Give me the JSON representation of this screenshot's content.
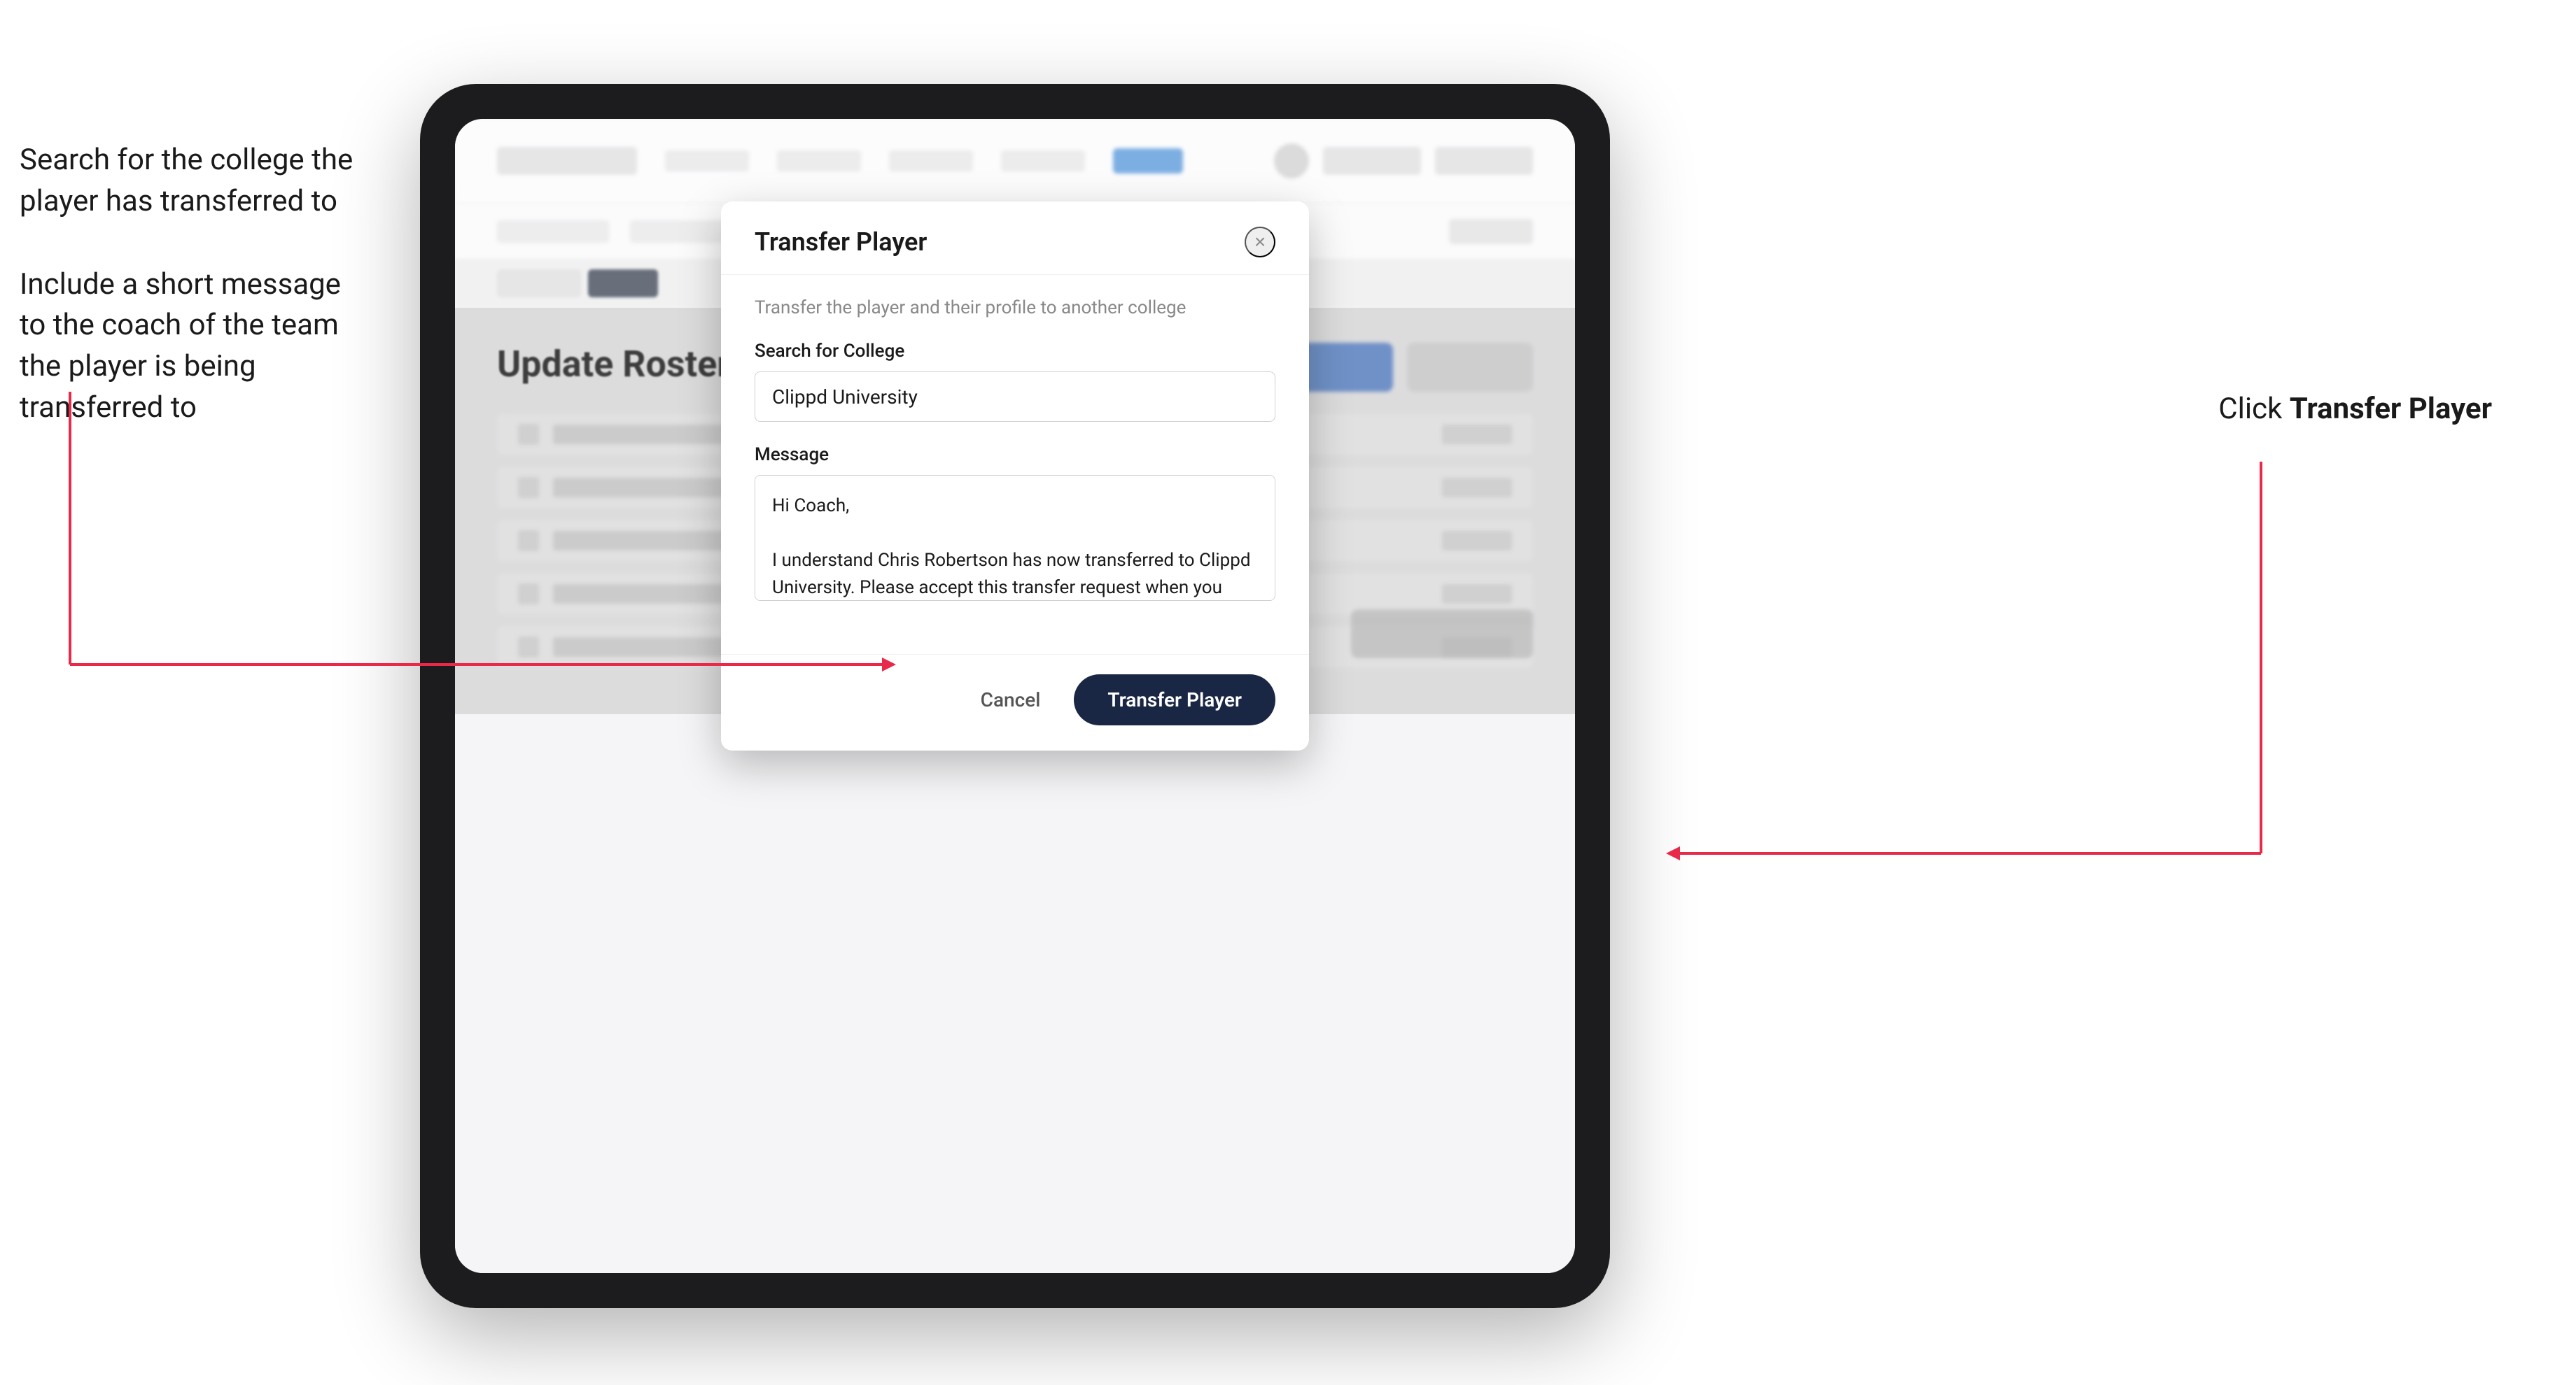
{
  "annotations": {
    "left_line1": "Search for the college the",
    "left_line2": "player has transferred to",
    "left_line3": "Include a short message",
    "left_line4": "to the coach of the team",
    "left_line5": "the player is being",
    "left_line6": "transferred to",
    "right_prefix": "Click ",
    "right_bold": "Transfer Player"
  },
  "modal": {
    "title": "Transfer Player",
    "subtitle": "Transfer the player and their profile to another college",
    "close_icon": "×",
    "search_label": "Search for College",
    "search_value": "Clippd University",
    "search_placeholder": "Search for College",
    "message_label": "Message",
    "message_value": "Hi Coach,\n\nI understand Chris Robertson has now transferred to Clippd University. Please accept this transfer request when you can.",
    "cancel_label": "Cancel",
    "transfer_label": "Transfer Player"
  },
  "app": {
    "roster_title": "Update Roster"
  }
}
